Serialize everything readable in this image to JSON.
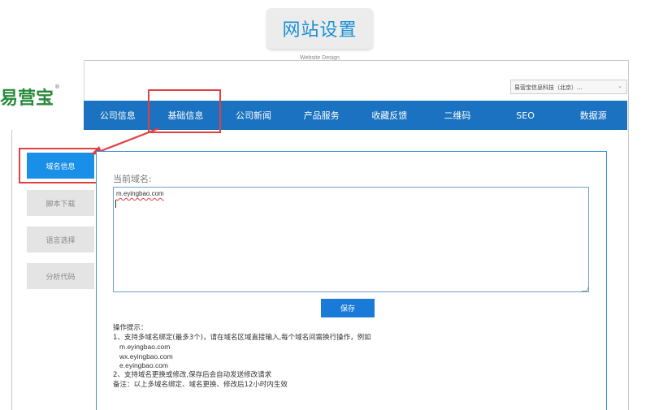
{
  "heading": {
    "title": "网站设置",
    "subtitle": "Website Design"
  },
  "logo": {
    "text": "易营宝",
    "mark": "®"
  },
  "company_select": {
    "value": "易营宝信息科技（北京）..."
  },
  "nav": {
    "items": [
      {
        "label": "公司信息"
      },
      {
        "label": "基础信息"
      },
      {
        "label": "公司新闻"
      },
      {
        "label": "产品服务"
      },
      {
        "label": "收藏反馈"
      },
      {
        "label": "二维码"
      },
      {
        "label": "SEO"
      },
      {
        "label": "数据源"
      }
    ],
    "active_index": 1
  },
  "sidebar": {
    "items": [
      {
        "label": "域名信息"
      },
      {
        "label": "脚本下载"
      },
      {
        "label": "语言选择"
      },
      {
        "label": "分析代码"
      }
    ],
    "active_index": 0
  },
  "panel": {
    "domain_label": "当前域名:",
    "domain_value": "m.eyingbao.com",
    "save_label": "保存",
    "hints": {
      "title": "操作提示：",
      "line1": "1、支持多域名绑定(最多3个)，请在域名区域直接输入,每个域名间需换行操作，例如",
      "examples": [
        "m.eyingbao.com",
        "wx.eyingbao.com",
        "e.eyingbao.com"
      ],
      "line2": "2、支持域名更换或修改,保存后会自动发送修改请求",
      "note": "备注：以上多域名绑定、域名更换、修改后12小时内生效"
    }
  },
  "colors": {
    "nav_bg": "#1a72c0",
    "accent": "#1a8fe8",
    "highlight": "#e24040",
    "logo": "#2a8a3c"
  }
}
